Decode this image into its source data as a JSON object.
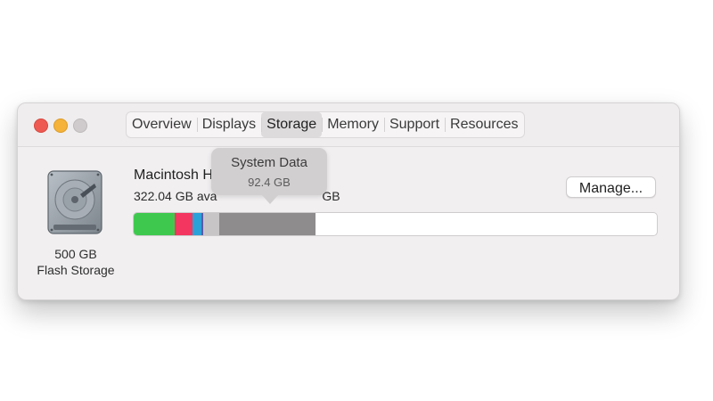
{
  "window": {
    "tabs": [
      {
        "label": "Overview"
      },
      {
        "label": "Displays"
      },
      {
        "label": "Storage",
        "active": true
      },
      {
        "label": "Memory"
      },
      {
        "label": "Support"
      },
      {
        "label": "Resources"
      }
    ]
  },
  "disk": {
    "icon": "hard-drive-icon",
    "capacity": "500 GB",
    "type": "Flash Storage"
  },
  "volume": {
    "name": "Macintosh H",
    "available": "322.04 GB ava",
    "available_tail": "GB",
    "manage_label": "Manage..."
  },
  "storage_bar": {
    "segments": [
      {
        "color": "#3ec94e",
        "fraction": 0.079
      },
      {
        "color": "#f2365f",
        "fraction": 0.034
      },
      {
        "color": "#2aa1d9",
        "fraction": 0.016
      },
      {
        "color": "#5c5aa8",
        "fraction": 0.004
      },
      {
        "color": "#c7c5c6",
        "fraction": 0.031
      },
      {
        "color": "#8e8c8d",
        "fraction": 0.184
      }
    ]
  },
  "tooltip": {
    "title": "System Data",
    "value": "92.4 GB"
  }
}
